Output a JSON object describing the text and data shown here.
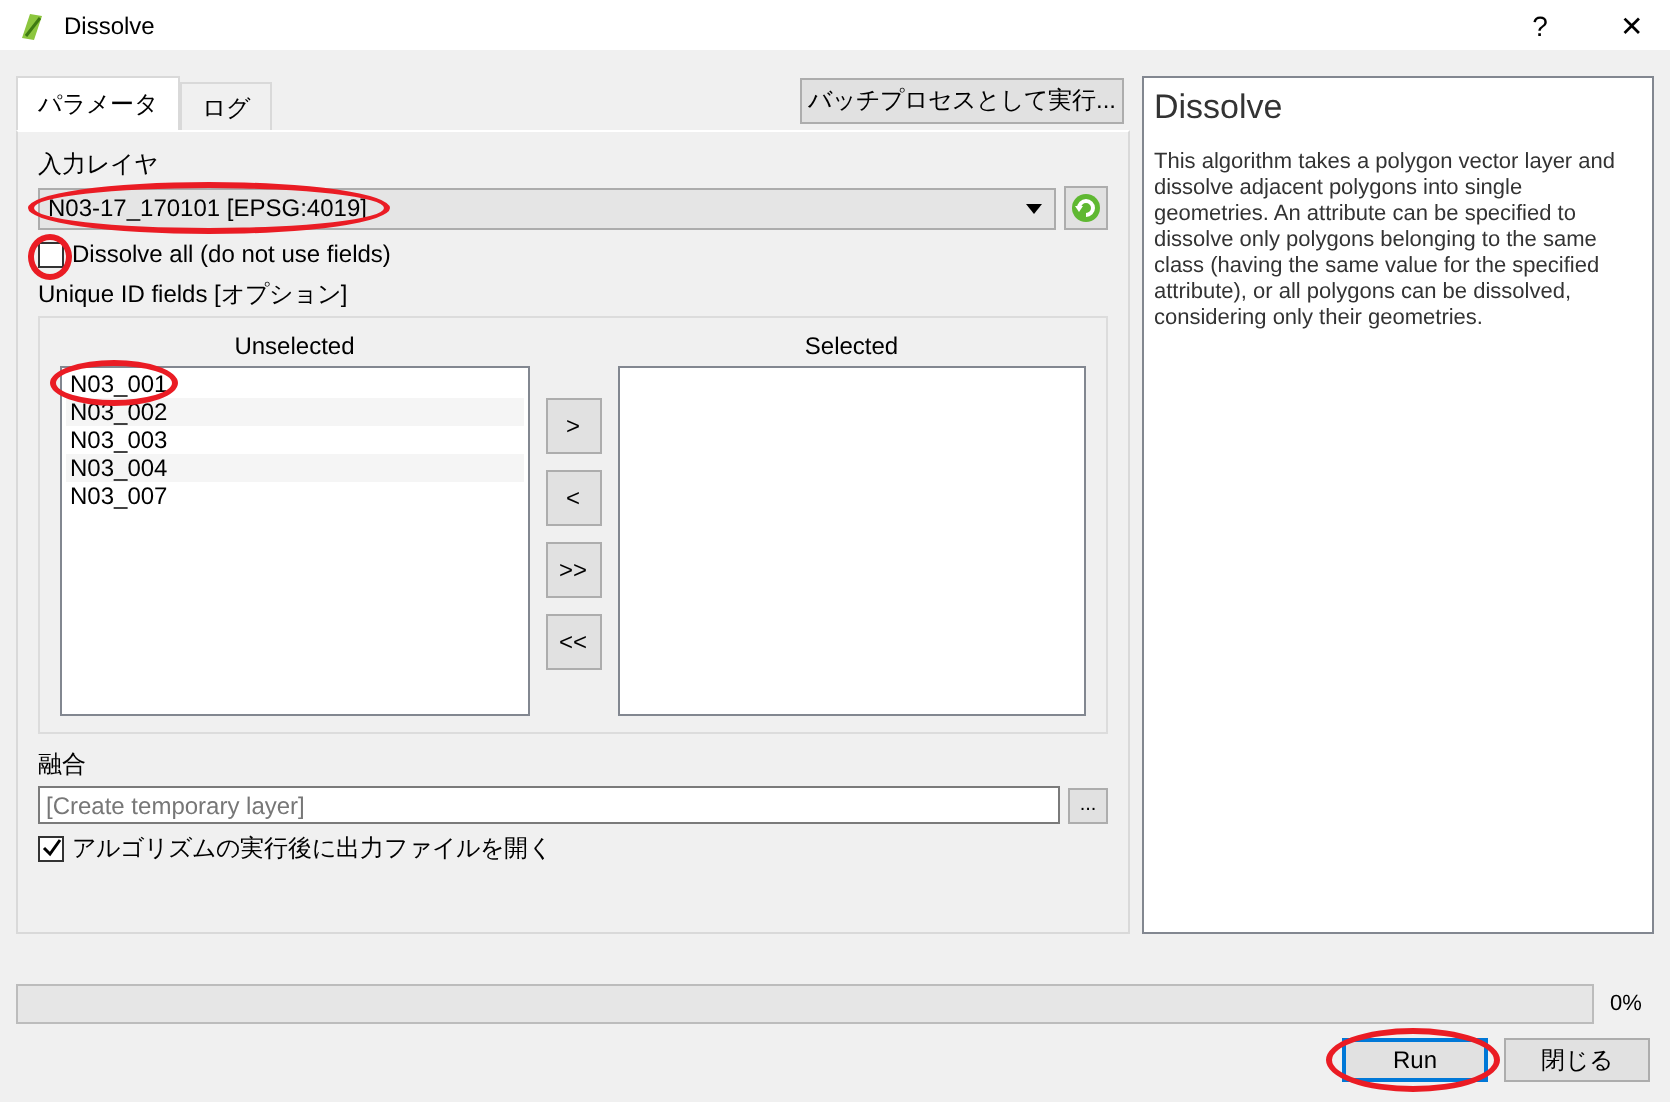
{
  "window": {
    "title": "Dissolve",
    "help_button": "?",
    "close_button": "✕"
  },
  "tabs": [
    {
      "label": "パラメータ",
      "selected": true
    },
    {
      "label": "ログ",
      "selected": false
    }
  ],
  "batch_button": "バッチプロセスとして実行...",
  "input_layer": {
    "label": "入力レイヤ",
    "value": "N03-17_170101 [EPSG:4019]",
    "highlighted": true
  },
  "dissolve_all": {
    "label": "Dissolve all (do not use fields)",
    "checked": false,
    "highlighted": true
  },
  "unique_fields": {
    "label": "Unique ID fields [オプション]",
    "unselected_title": "Unselected",
    "selected_title": "Selected",
    "unselected": [
      {
        "name": "N03_001",
        "highlighted": true
      },
      {
        "name": "N03_002",
        "highlighted": false
      },
      {
        "name": "N03_003",
        "highlighted": false
      },
      {
        "name": "N03_004",
        "highlighted": false
      },
      {
        "name": "N03_007",
        "highlighted": false
      }
    ],
    "move_buttons": [
      ">",
      "<",
      ">>",
      "<<"
    ]
  },
  "output": {
    "label": "融合",
    "placeholder": "[Create temporary layer]",
    "browse_button": "..."
  },
  "open_after": {
    "label": "アルゴリズムの実行後に出力ファイルを開く",
    "checked": true
  },
  "help": {
    "title": "Dissolve",
    "text": "This algorithm takes a polygon vector layer and dissolve adjacent polygons into single geometries. An attribute can be specified to dissolve only polygons belonging to the same class (having the same value for the specified attribute), or all polygons can be dissolved, considering only their geometries."
  },
  "progress": {
    "level": 0,
    "reading": "0%"
  },
  "buttons": [
    {
      "label": "Run",
      "default": true,
      "highlighted": true
    },
    {
      "label": "閉じる",
      "default": false,
      "highlighted": false
    }
  ]
}
